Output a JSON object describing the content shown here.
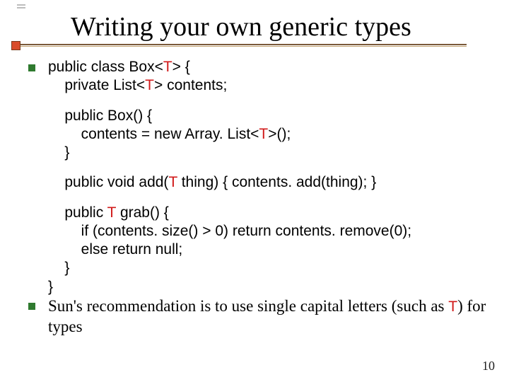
{
  "title": "Writing your own generic types",
  "code": {
    "l1a": "public class Box<",
    "l1b": "> {",
    "l2a": "    private List<",
    "l2b": "> contents;",
    "l3": "    public Box() {",
    "l4a": "        contents = new Array. List<",
    "l4b": ">();",
    "l5": "    }",
    "l6a": "    public void add(",
    "l6b": " thing) { contents. add(thing); }",
    "l7a": "    public ",
    "l7b": " grab() {",
    "l8": "        if (contents. size() > 0) return contents. remove(0);",
    "l9": "        else return null;",
    "l10": "    }",
    "l11": "}",
    "T": "T"
  },
  "note": {
    "a": "Sun's recommendation is to use single capital letters (such as ",
    "b": ") for types"
  },
  "page": "10"
}
